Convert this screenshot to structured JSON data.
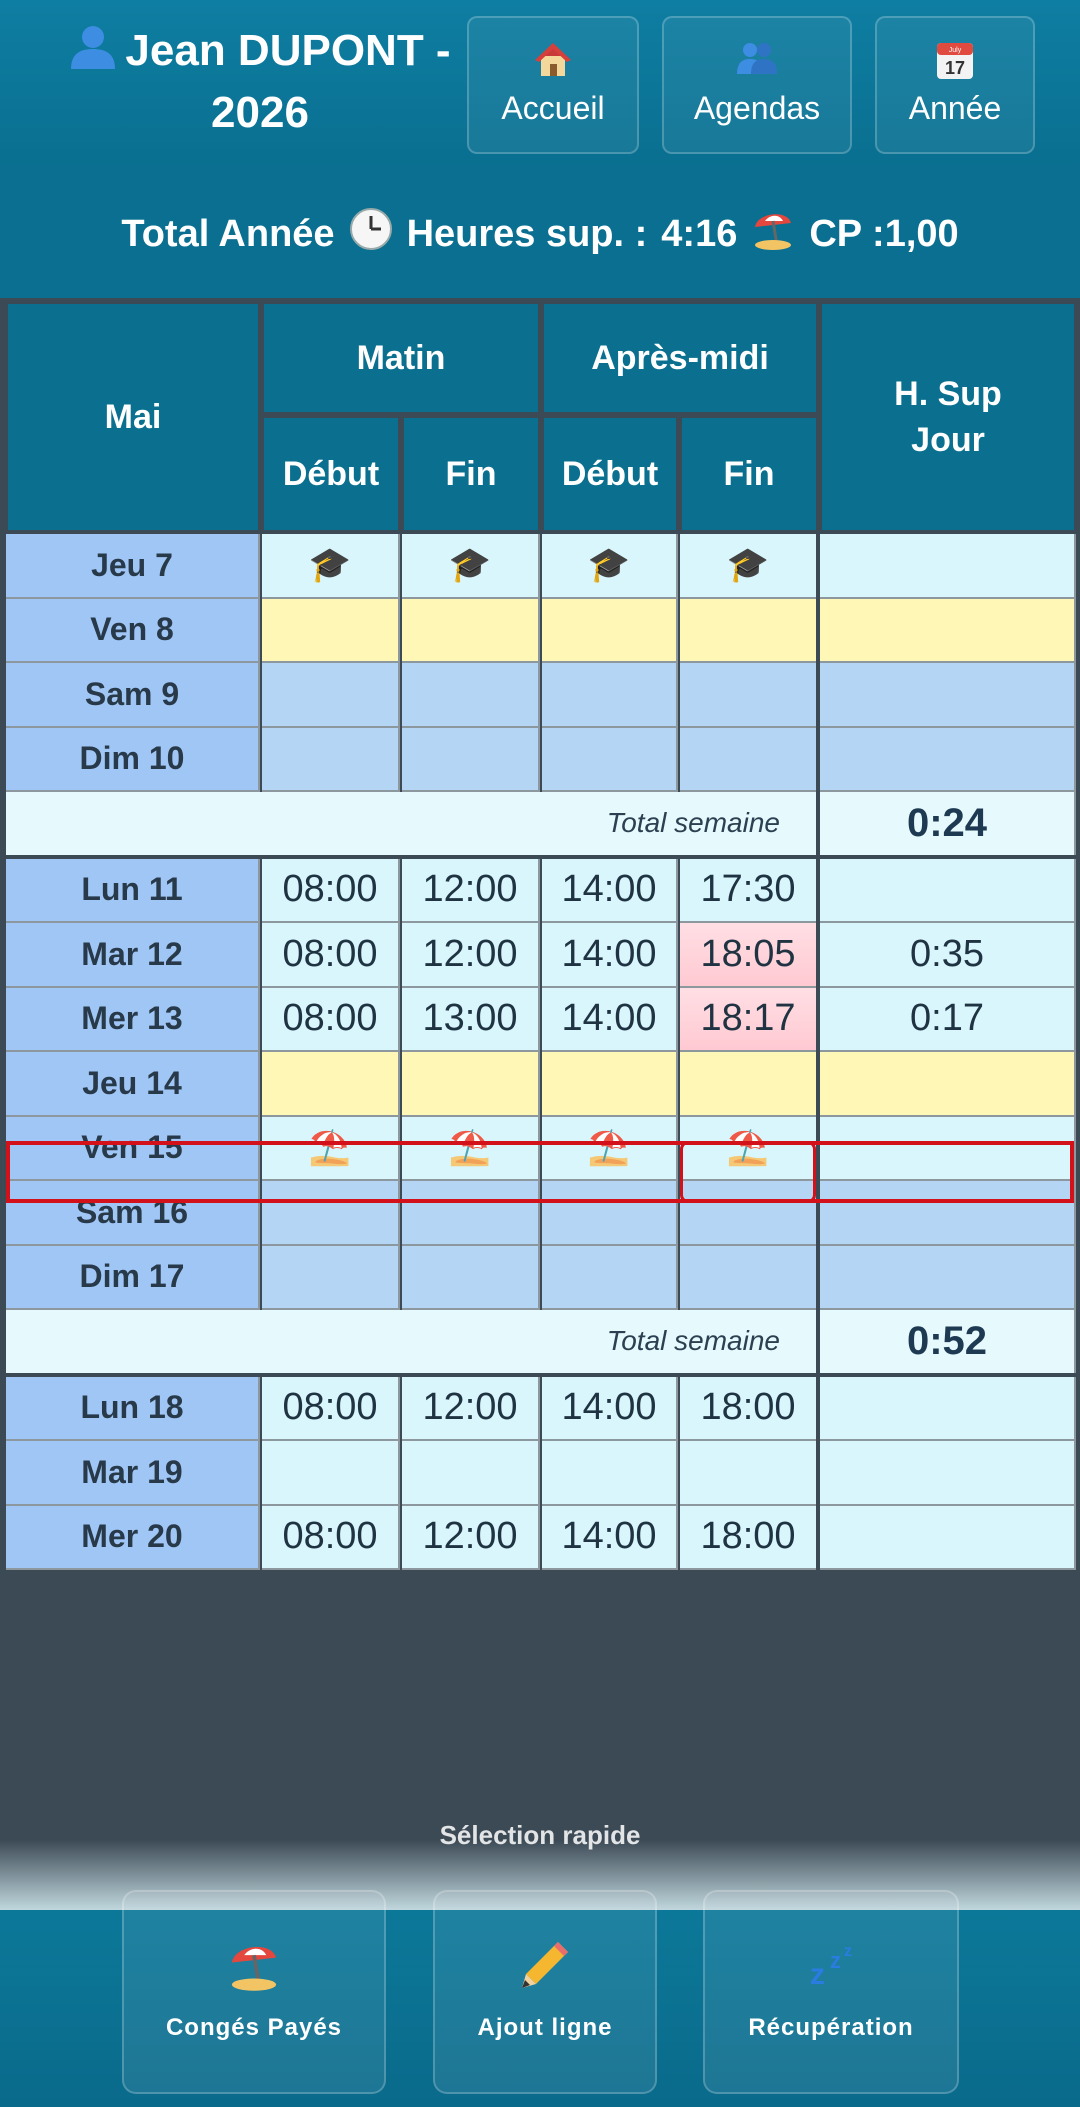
{
  "header": {
    "user": "Jean DUPONT -",
    "year": "2026",
    "nav": [
      {
        "label": "Accueil",
        "icon": "house-icon"
      },
      {
        "label": "Agendas",
        "icon": "people-icon"
      },
      {
        "label": "Année",
        "icon": "calendar-icon",
        "calendar_month": "July",
        "calendar_day": "17"
      }
    ]
  },
  "totals": {
    "label": "Total Année",
    "overtime_label": "Heures sup. :",
    "overtime_value": "4:16",
    "cp_label": "CP :",
    "cp_value": "1,00"
  },
  "table": {
    "month": "Mai",
    "morning": "Matin",
    "afternoon": "Après-midi",
    "start": "Début",
    "end": "Fin",
    "hsup_line1": "H. Sup",
    "hsup_line2": "Jour",
    "week_total_label": "Total semaine",
    "rows": [
      {
        "day": "Jeu 7",
        "vals": [
          "🎓",
          "🎓",
          "🎓",
          "🎓"
        ],
        "hsup": ""
      },
      {
        "day": "Ven 8",
        "vals": [
          "",
          "",
          "",
          ""
        ],
        "hsup": ""
      },
      {
        "day": "Sam 9",
        "vals": [
          "",
          "",
          "",
          ""
        ],
        "hsup": ""
      },
      {
        "day": "Dim 10",
        "vals": [
          "",
          "",
          "",
          ""
        ],
        "hsup": ""
      },
      {
        "week_total": "0:24"
      },
      {
        "day": "Lun 11",
        "vals": [
          "08:00",
          "12:00",
          "14:00",
          "17:30"
        ],
        "hsup": ""
      },
      {
        "day": "Mar 12",
        "vals": [
          "08:00",
          "12:00",
          "14:00",
          "18:05"
        ],
        "hsup": "0:35"
      },
      {
        "day": "Mer 13",
        "vals": [
          "08:00",
          "13:00",
          "14:00",
          "18:17"
        ],
        "hsup": "0:17"
      },
      {
        "day": "Jeu 14",
        "vals": [
          "",
          "",
          "",
          ""
        ],
        "hsup": ""
      },
      {
        "day": "Ven 15",
        "vals": [
          "⛱️",
          "⛱️",
          "⛱️",
          "⛱️"
        ],
        "hsup": ""
      },
      {
        "day": "Sam 16",
        "vals": [
          "",
          "",
          "",
          ""
        ],
        "hsup": ""
      },
      {
        "day": "Dim 17",
        "vals": [
          "",
          "",
          "",
          ""
        ],
        "hsup": ""
      },
      {
        "week_total": "0:52"
      },
      {
        "day": "Lun 18",
        "vals": [
          "08:00",
          "12:00",
          "14:00",
          "18:00"
        ],
        "hsup": ""
      },
      {
        "day": "Mar 19",
        "vals": [
          "",
          "",
          "",
          ""
        ],
        "hsup": ""
      },
      {
        "day": "Mer 20",
        "vals": [
          "08:00",
          "12:00",
          "14:00",
          "18:00"
        ],
        "hsup": ""
      }
    ]
  },
  "quick": {
    "title": "Sélection rapide",
    "buttons": [
      {
        "label": "Congés Payés",
        "icon": "beach-umbrella-icon"
      },
      {
        "label": "Ajout ligne",
        "icon": "pencil-icon"
      },
      {
        "label": "Récupération",
        "icon": "sleep-icon"
      }
    ]
  }
}
